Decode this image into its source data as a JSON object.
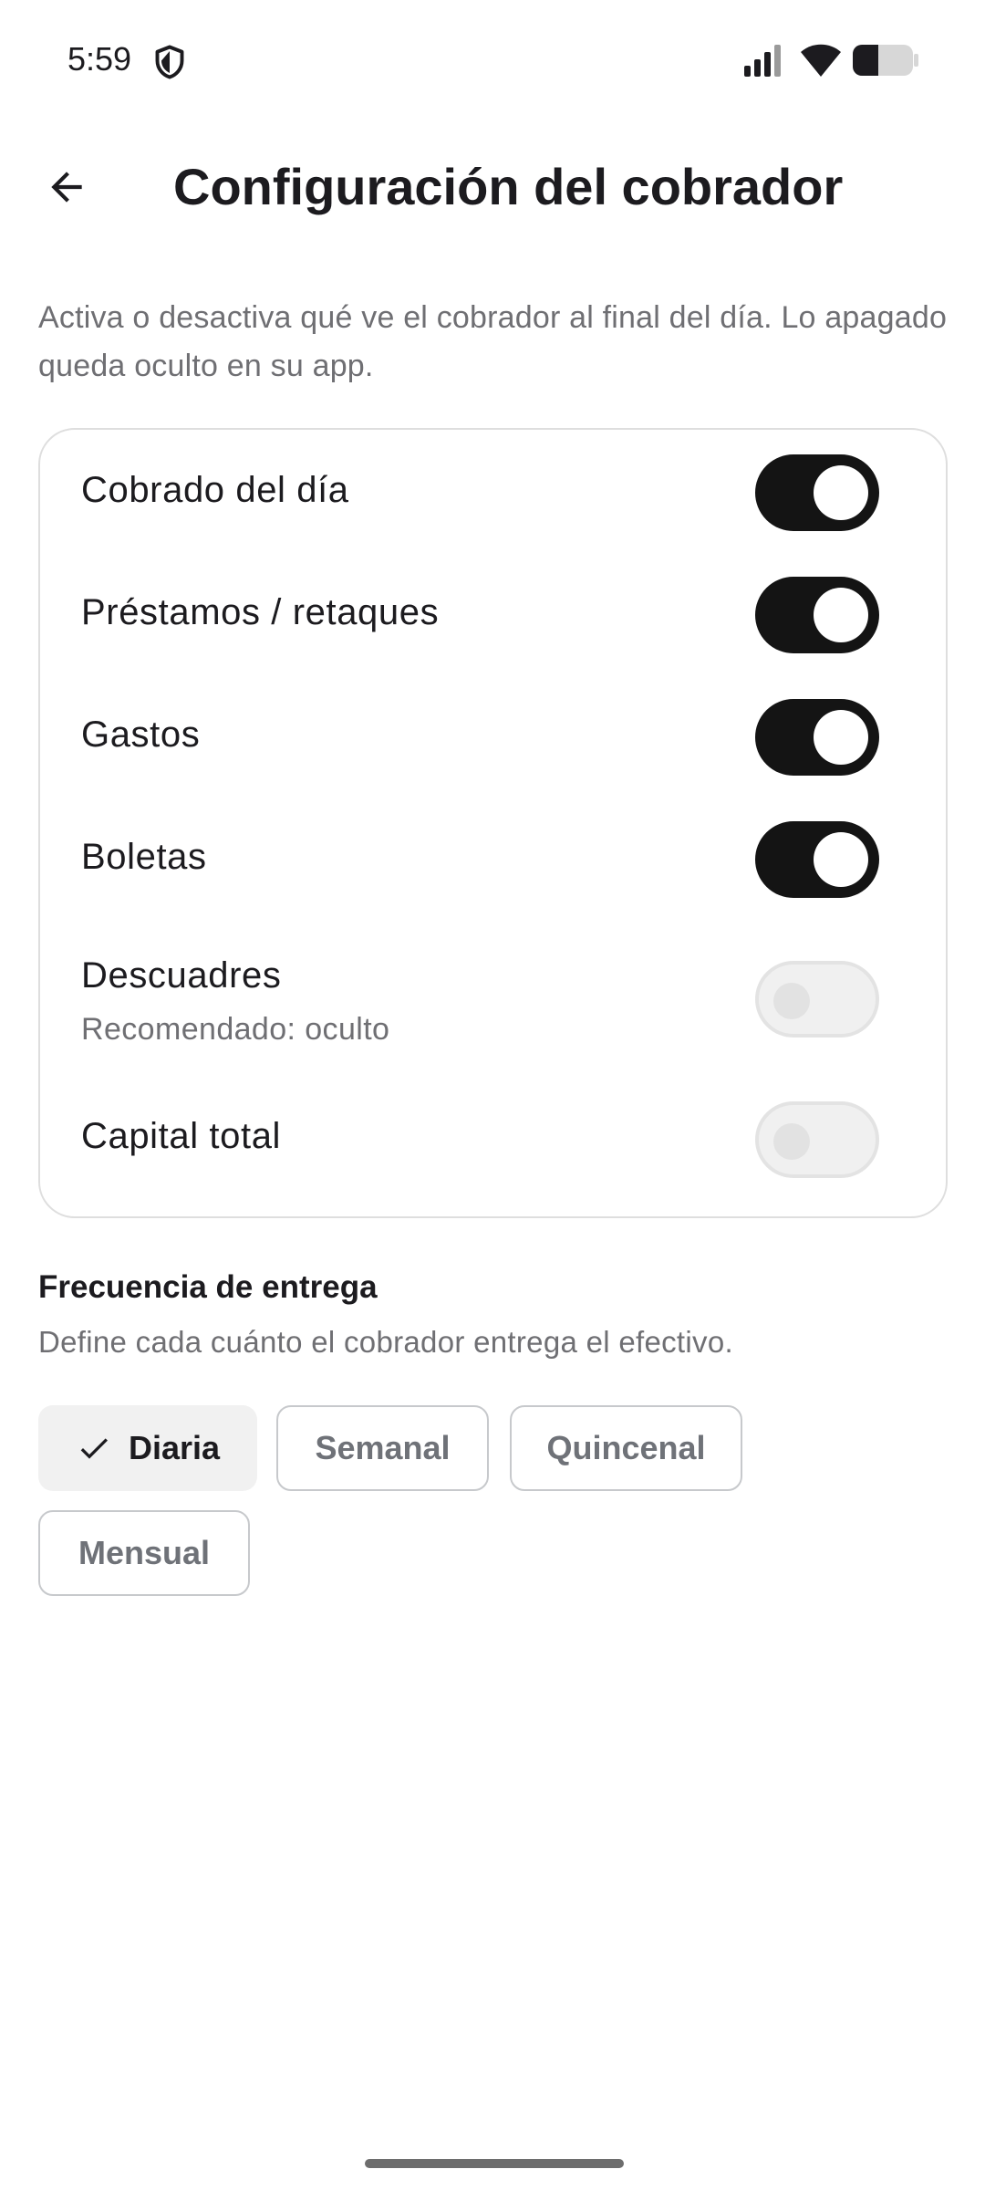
{
  "status_bar": {
    "time": "5:59",
    "icons": [
      "shield-icon",
      "signal-icon",
      "wifi-icon",
      "battery-icon"
    ]
  },
  "app_bar": {
    "back_icon": "arrow-back-icon",
    "title": "Configuración del cobrador"
  },
  "intro": "Activa o desactiva qué ve el cobrador al final del día. Lo apagado queda oculto en su app.",
  "settings": [
    {
      "label": "Cobrado del día",
      "sublabel": "",
      "enabled": true
    },
    {
      "label": "Préstamos / retaques",
      "sublabel": "",
      "enabled": true
    },
    {
      "label": "Gastos",
      "sublabel": "",
      "enabled": true
    },
    {
      "label": "Boletas",
      "sublabel": "",
      "enabled": true
    },
    {
      "label": "Descuadres",
      "sublabel": "Recomendado: oculto",
      "enabled": false
    },
    {
      "label": "Capital total",
      "sublabel": "",
      "enabled": false
    }
  ],
  "frequency": {
    "title": "Frecuencia de entrega",
    "description": "Define cada cuánto el cobrador entrega el efectivo.",
    "options": [
      {
        "label": "Diaria",
        "selected": true
      },
      {
        "label": "Semanal",
        "selected": false
      },
      {
        "label": "Quincenal",
        "selected": false
      },
      {
        "label": "Mensual",
        "selected": false
      }
    ]
  },
  "colors": {
    "switch_on": "#141414",
    "switch_off": "#f0f0f0",
    "secondary_text": "#6f6f73"
  }
}
